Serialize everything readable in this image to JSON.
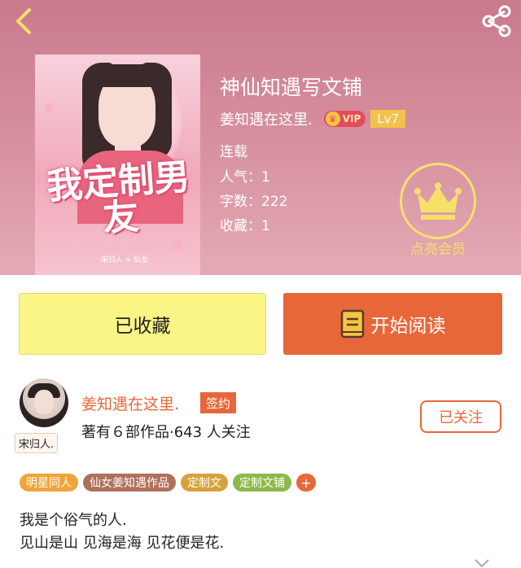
{
  "book": {
    "title": "神仙知遇写文铺",
    "author": "姜知遇在这里.",
    "vip_label": "VIP",
    "level": "Lv7",
    "status": "连载",
    "popularity": "人气：1",
    "word_count": "字数：222",
    "favorites": "收藏：1",
    "cover_title": "我定制男友",
    "cover_caption": "宋归人 × 仙女"
  },
  "member": {
    "label": "点亮会员"
  },
  "actions": {
    "favorite_label": "已收藏",
    "read_label": "开始阅读"
  },
  "author_card": {
    "avatar_tag": "宋归人.",
    "name": "姜知遇在这里.",
    "sign_badge": "签约",
    "stats": "著有６部作品·643 人关注",
    "follow_label": "已关注"
  },
  "tags": [
    {
      "label": "明星同人",
      "color": "#f0a43a"
    },
    {
      "label": "仙女姜知遇作品",
      "color": "#b0705a"
    },
    {
      "label": "定制文",
      "color": "#d9a13a"
    },
    {
      "label": "定制文铺",
      "color": "#8fb84a"
    }
  ],
  "tag_add": "+",
  "description": [
    "我是个俗气的人.",
    "见山是山  见海是海 见花便是花."
  ],
  "colors": {
    "accent": "#e8673a",
    "favorite_bg": "#fbf586",
    "member_gold": "#f5e06a"
  }
}
